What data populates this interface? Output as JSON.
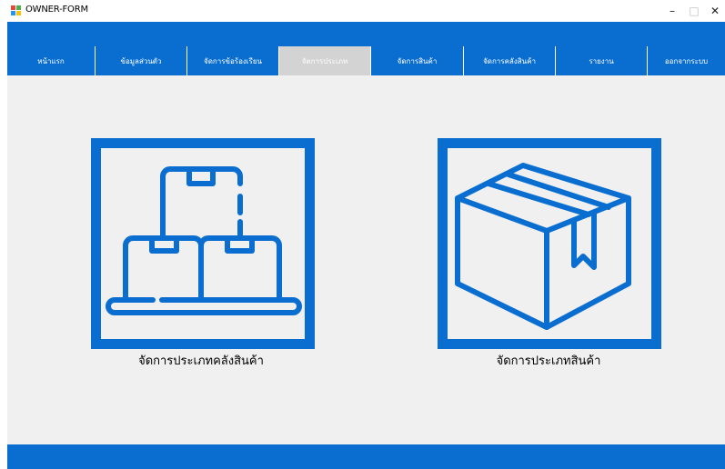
{
  "window": {
    "title": "OWNER-FORM",
    "minimize_glyph": "–",
    "maximize_glyph": "□",
    "close_glyph": "✕"
  },
  "nav": {
    "items": [
      {
        "label": "หน้าแรก",
        "active": false
      },
      {
        "label": "ข้อมูลส่วนตัว",
        "active": false
      },
      {
        "label": "จัดการข้อร้องเรียน",
        "active": false
      },
      {
        "label": "จัดการประเภท",
        "active": true
      },
      {
        "label": "จัดการสินค้า",
        "active": false
      },
      {
        "label": "จัดการคลังสินค้า",
        "active": false
      },
      {
        "label": "รายงาน",
        "active": false
      },
      {
        "label": "ออกจากระบบ",
        "active": false
      }
    ]
  },
  "tiles": {
    "warehouse_category": {
      "caption": "จัดการประเภทคลังสินค้า",
      "icon": "stacked-boxes-icon"
    },
    "product_category": {
      "caption": "จัดการประเภทสินค้า",
      "icon": "box-icon"
    }
  },
  "colors": {
    "accent": "#0a6ed1",
    "active_tab": "#d3d3d3",
    "background": "#f0f0f0"
  }
}
